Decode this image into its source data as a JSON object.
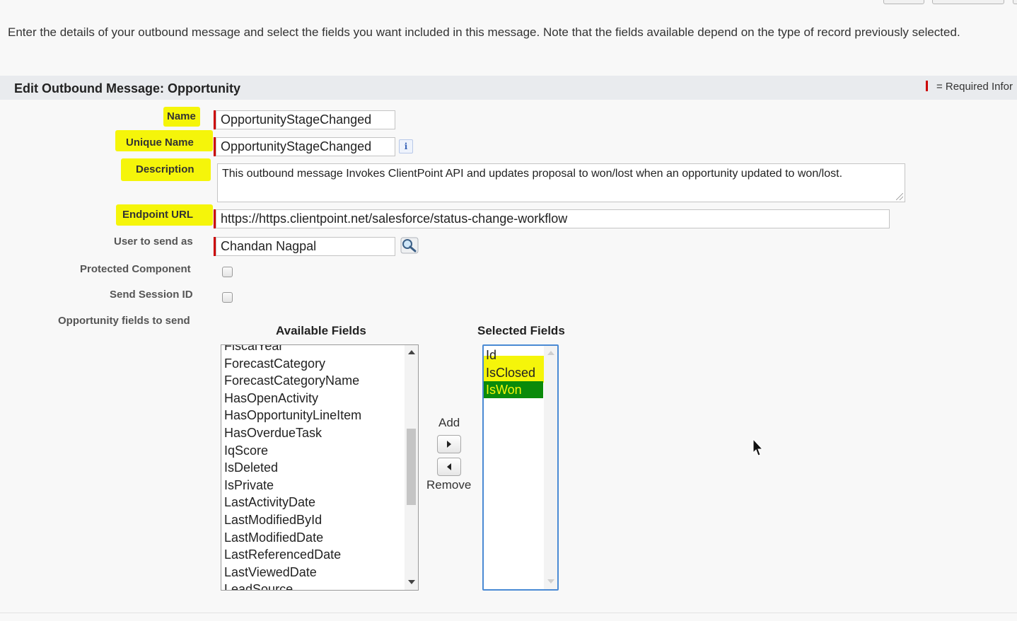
{
  "intro_text": "Enter the details of your outbound message and select the fields you want included in this message. Note that the fields available depend on the type of record previously selected.",
  "section": {
    "title": "Edit Outbound Message: Opportunity",
    "required_legend": "= Required Infor"
  },
  "labels": {
    "name": "Name",
    "unique_name": "Unique Name",
    "description": "Description",
    "endpoint_url": "Endpoint URL",
    "user_to_send_as": "User to send as",
    "protected_component": "Protected Component",
    "send_session_id": "Send Session ID",
    "fields_to_send": "Opportunity fields to send"
  },
  "values": {
    "name": "OpportunityStageChanged",
    "unique_name": "OpportunityStageChanged",
    "description": "This outbound message Invokes ClientPoint API and updates proposal to won/lost when an opportunity updated to won/lost.",
    "endpoint_url": "https://https.clientpoint.net/salesforce/status-change-workflow",
    "user_to_send_as": "Chandan Nagpal",
    "protected_component": false,
    "send_session_id": false
  },
  "picklist": {
    "available_header": "Available Fields",
    "selected_header": "Selected Fields",
    "add_label": "Add",
    "remove_label": "Remove",
    "available": [
      "FiscalYear",
      "ForecastCategory",
      "ForecastCategoryName",
      "HasOpenActivity",
      "HasOpportunityLineItem",
      "HasOverdueTask",
      "IqScore",
      "IsDeleted",
      "IsPrivate",
      "LastActivityDate",
      "LastModifiedById",
      "LastModifiedDate",
      "LastReferencedDate",
      "LastViewedDate",
      "LeadSource"
    ],
    "selected": [
      "Id",
      "IsClosed",
      "IsWon"
    ],
    "selected_highlighted": "IsWon"
  },
  "colors": {
    "highlight_yellow": "#f5f50a",
    "selected_option_green": "#0a8a0a",
    "required_red": "#cc0000",
    "selected_list_border": "#4a8ad4"
  }
}
